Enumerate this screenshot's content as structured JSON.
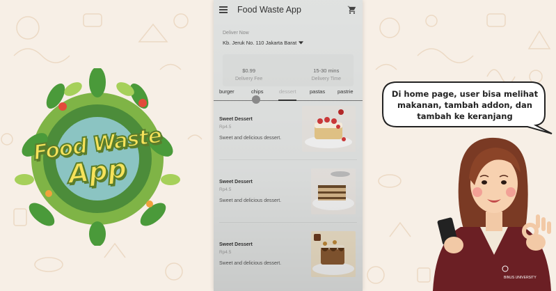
{
  "app": {
    "title": "Food Waste App",
    "menu_icon": "hamburger-menu-icon",
    "cart_icon": "shopping-cart-icon"
  },
  "delivery": {
    "label": "Deliver Now",
    "address": "Kb. Jeruk No. 110 Jakarta Barat"
  },
  "info": {
    "fee_value": "$0.99",
    "fee_label": "Delivery Fee",
    "time_value": "15-30 mins",
    "time_label": "Delivery Time"
  },
  "tabs": [
    {
      "label": "burger",
      "active": true
    },
    {
      "label": "chips",
      "active": true
    },
    {
      "label": "dessert",
      "active": false
    },
    {
      "label": "pastas",
      "active": true
    },
    {
      "label": "pastrie",
      "active": true
    }
  ],
  "foods": [
    {
      "name": "Sweet Dessert",
      "price": "Rp4.5",
      "description": "Sweet and delicious dessert."
    },
    {
      "name": "Sweet Dessert",
      "price": "Rp4.5",
      "description": "Sweet and delicious dessert."
    },
    {
      "name": "Sweet Dessert",
      "price": "Rp4.5",
      "description": "Sweet and delicious dessert."
    }
  ],
  "logo": {
    "line1": "Food Waste",
    "line2": "App"
  },
  "bubble": {
    "text": "Di home page, user bisa melihat makanan, tambah addon, dan tambah ke keranjang"
  },
  "badge": {
    "text": "BINUS UNIVERSITY"
  },
  "colors": {
    "background": "#f7efe6",
    "phone_bg": "#e4e6e5",
    "logo_yellow": "#f6e25a",
    "logo_green": "#5a7d2b",
    "jacket": "#6b1f24"
  }
}
